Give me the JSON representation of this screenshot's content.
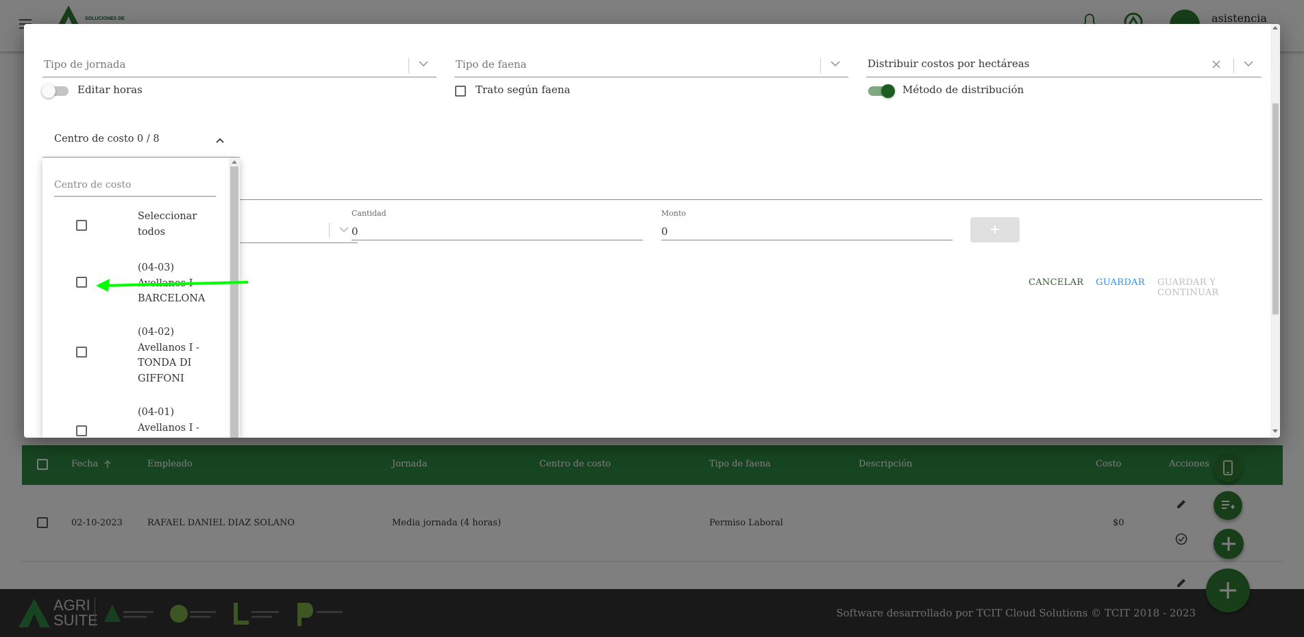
{
  "app_bar": {
    "user_name": "asistencia",
    "logo_text": "SOLUCIONES DE"
  },
  "dialog": {
    "tipo_jornada": {
      "label": "Tipo de jornada"
    },
    "tipo_faena": {
      "label": "Tipo de faena"
    },
    "distribuir": {
      "value": "Distribuir costos por hectáreas"
    },
    "editar_horas": {
      "label": "Editar horas",
      "on": false
    },
    "trato_faena": {
      "label": "Trato según faena",
      "checked": false
    },
    "metodo_distribucion": {
      "label": "Método de distribución",
      "on": true
    },
    "cost_center_toggle": {
      "label": "Centro de costo 0 / 8"
    },
    "cantidad": {
      "label": "Cantidad",
      "value": "0"
    },
    "monto": {
      "label": "Monto",
      "value": "0"
    },
    "actions": {
      "cancel": "CANCELAR",
      "save": "GUARDAR",
      "save_continue": "GUARDAR Y CONTINUAR"
    }
  },
  "dropdown": {
    "search_placeholder": "Centro de costo",
    "items": [
      {
        "label": "Seleccionar todos",
        "checked": false
      },
      {
        "label": "(04-03) Avellanos I - BARCELONA",
        "checked": false
      },
      {
        "label": "(04-02) Avellanos I - TONDA DI GIFFONI",
        "checked": false
      },
      {
        "label": "(04-01) Avellanos I -",
        "checked": false
      }
    ]
  },
  "table": {
    "headers": [
      "Fecha",
      "Empleado",
      "Jornada",
      "Centro de costo",
      "Tipo de faena",
      "Descripción",
      "Costo",
      "Acciones"
    ],
    "rows": [
      {
        "fecha": "02-10-2023",
        "empleado": "RAFAEL DANIEL DIAZ SOLANO",
        "jornada": "Media jornada (4 horas)",
        "centro": "",
        "faena": "Permiso Laboral",
        "descripcion": "",
        "costo": "$0"
      }
    ]
  },
  "footer": {
    "copyright": "Software desarrollado por TCIT Cloud Solutions © TCIT 2018 - 2023",
    "brand_line1": "AGRI",
    "brand_line2": "SUITE"
  },
  "colors": {
    "primary_green": "#2e7d32",
    "header_green": "#2f8a43",
    "save_blue": "#2196f3",
    "annotation_arrow": "#00ff00"
  }
}
